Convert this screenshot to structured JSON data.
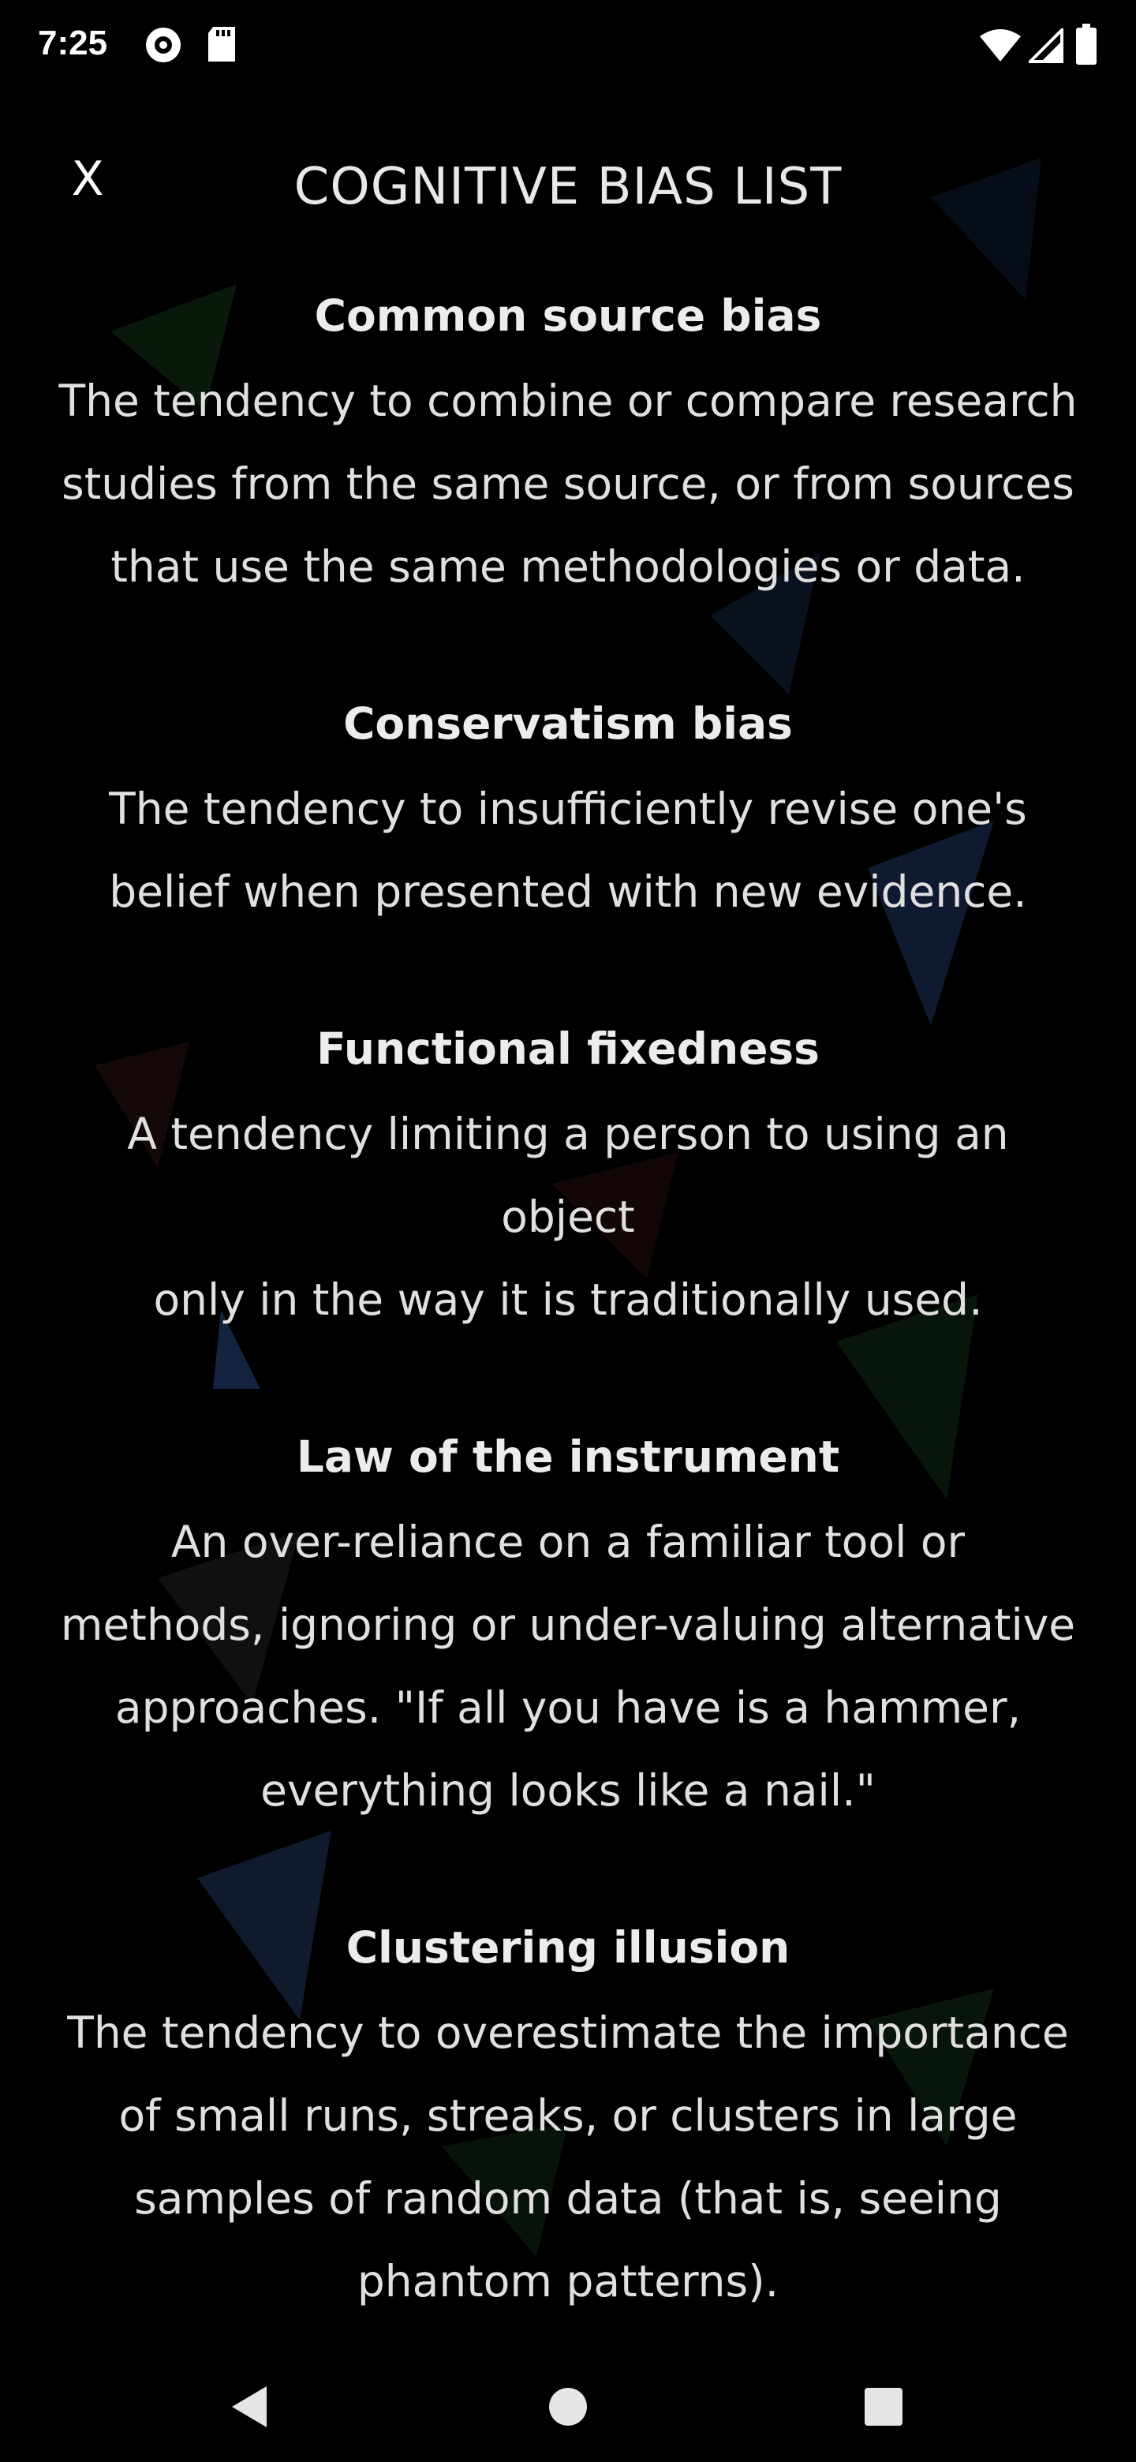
{
  "status_bar": {
    "time": "7:25",
    "icons_left": [
      "pocket-casts-icon",
      "sd-card-icon"
    ],
    "icons_right": [
      "wifi-icon",
      "cellular-signal-icon",
      "battery-icon"
    ]
  },
  "header": {
    "close_label": "X",
    "title": "COGNITIVE BIAS LIST"
  },
  "biases": [
    {
      "name": "Common source bias",
      "description_lines": [
        "The tendency to combine or compare research",
        "studies from the same source, or from sources",
        "that use the same methodologies or data."
      ]
    },
    {
      "name": "Conservatism bias",
      "description_lines": [
        "The tendency to insufficiently revise one's",
        "belief when presented with new evidence."
      ]
    },
    {
      "name": "Functional fixedness",
      "description_lines": [
        "A tendency limiting a person to using an object",
        "only in the way it is traditionally used."
      ]
    },
    {
      "name": "Law of the instrument",
      "description_lines": [
        "An over-reliance on a familiar tool or",
        "methods, ignoring or under-valuing alternative",
        "approaches. \"If all you have is a hammer,",
        "everything looks like a nail.\""
      ]
    },
    {
      "name": "Clustering illusion",
      "description_lines": [
        "The tendency to overestimate the importance",
        "of small runs, streaks, or clusters in large",
        "samples of random data (that is, seeing",
        "phantom patterns)."
      ]
    }
  ],
  "nav_bar": {
    "buttons": [
      "back-icon",
      "home-icon",
      "recents-icon"
    ]
  },
  "colors": {
    "background": "#000000",
    "text": "#e6e6e6"
  }
}
